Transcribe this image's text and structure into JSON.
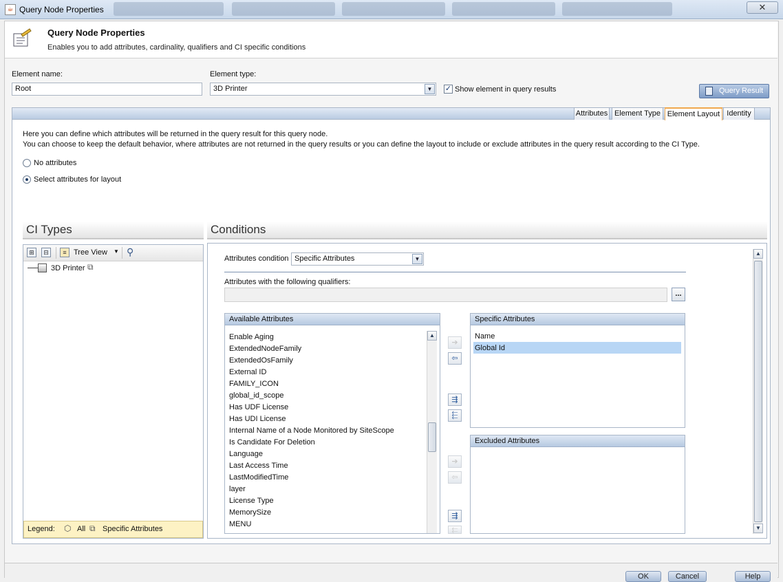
{
  "window": {
    "title": "Query Node Properties",
    "close_glyph": "✕"
  },
  "header": {
    "title": "Query Node Properties",
    "subtitle": "Enables you to add attributes, cardinality, qualifiers and CI specific conditions"
  },
  "element": {
    "name_label": "Element name:",
    "name_value": "Root",
    "type_label": "Element type:",
    "type_value": "3D Printer",
    "show_in_results_label": "Show element in query results",
    "show_in_results_checked": true
  },
  "query_result_button": "Query Result",
  "tabs": [
    {
      "label": "Attributes",
      "active": false
    },
    {
      "label": "Element Type",
      "active": false
    },
    {
      "label": "Element Layout",
      "active": true
    },
    {
      "label": "Identity",
      "active": false
    }
  ],
  "layout_info": {
    "line1": "Here you can define which attributes will be returned in the query result for this query node.",
    "line2": "You can choose to keep the default behavior, where attributes are not returned in the query results or you can define the layout to include or exclude attributes in the query result according to the CI Type.",
    "option_none": "No attributes",
    "option_select": "Select attributes for layout",
    "selected_option": "select"
  },
  "ci_types": {
    "title": "CI Types",
    "view_label": "Tree View",
    "tree_item": "3D Printer",
    "legend_label": "Legend:",
    "legend_all": "All",
    "legend_specific": "Specific Attributes"
  },
  "conditions": {
    "title": "Conditions",
    "attr_condition_label": "Attributes condition",
    "attr_condition_value": "Specific Attributes",
    "qualifiers_label": "Attributes with the following qualifiers:",
    "qualifiers_value": "",
    "browse_label": "...",
    "available_title": "Available Attributes",
    "available_items": [
      "Enable Aging",
      "ExtendedNodeFamily",
      "ExtendedOsFamily",
      "External ID",
      "FAMILY_ICON",
      "global_id_scope",
      "Has UDF License",
      "Has UDI License",
      "Internal Name of a Node Monitored by SiteScope",
      "Is Candidate For Deletion",
      "Language",
      "Last Access Time",
      "LastModifiedTime",
      "layer",
      "License Type",
      "MemorySize",
      "MENU"
    ],
    "specific_title": "Specific Attributes",
    "specific_items": [
      "Name",
      "Global Id"
    ],
    "specific_selected": "Global Id",
    "excluded_title": "Excluded Attributes",
    "excluded_items": []
  },
  "footer": {
    "ok": "OK",
    "cancel": "Cancel",
    "help": "Help"
  },
  "colors": {
    "accent": "#f0a84e",
    "selection": "#b8d6f5",
    "legend_bg": "#fdf2c4"
  }
}
